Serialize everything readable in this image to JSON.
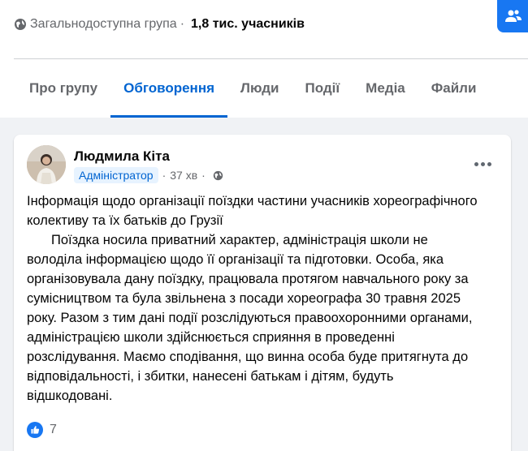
{
  "group": {
    "privacy": "Загальнодоступна група",
    "separator": "·",
    "members": "1,8 тис. учасників"
  },
  "tabs": [
    {
      "label": "Про групу",
      "active": false
    },
    {
      "label": "Обговорення",
      "active": true
    },
    {
      "label": "Люди",
      "active": false
    },
    {
      "label": "Події",
      "active": false
    },
    {
      "label": "Медіа",
      "active": false
    },
    {
      "label": "Файли",
      "active": false
    }
  ],
  "post": {
    "author": "Людмила Кіта",
    "role": "Адміністратор",
    "separator": "·",
    "time": "37 хв",
    "title_line": "Інформація щодо організації поїздки частини учасників хореографічного колективу та їх батьків до Грузії",
    "body": "Поїздка носила приватний характер, адміністрація школи  не володіла інформацією щодо її організації та підготовки. Особа, яка організовувала дану поїздку, працювала протягом навчального року за сумісництвом та була звільнена з посади хореографа 30 травня 2025 року. Разом з тим дані події розслідуються правоохоронними органами, адміністрацією школи здійснюється сприяння в проведенні розслідування. Маємо сподівання, що винна особа буде притягнута до відповідальності, і збитки, нанесені батькам і дітям, будуть відшкодовані.",
    "reaction_count": "7"
  },
  "colors": {
    "accent": "#0064d1",
    "brand_blue": "#1877f2",
    "secondary_text": "#65676b",
    "role_badge_bg": "#e7f3ff"
  },
  "icons": {
    "privacy": "globe-icon",
    "invite": "invite-people-icon",
    "post_audience": "public-globe-icon",
    "more": "more-options-icon",
    "reaction": "like-icon"
  }
}
